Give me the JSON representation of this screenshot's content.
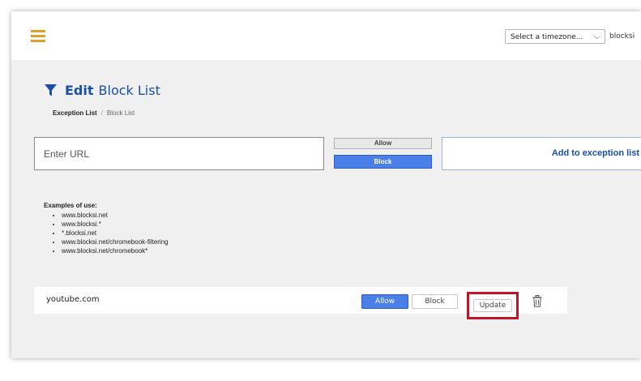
{
  "header": {
    "timezone_select": "Select a timezone...",
    "user_name": "blocksi"
  },
  "page": {
    "title_strong": "Edit",
    "title_rest": "Block List",
    "breadcrumb": [
      "Exception List",
      "Block List"
    ],
    "breadcrumb_separator": "/"
  },
  "form": {
    "url_placeholder": "Enter URL",
    "allow_label": "Allow",
    "block_label": "Block",
    "add_button": "Add to exception list"
  },
  "examples": {
    "title": "Examples of use:",
    "items": [
      "www.blocksi.net",
      "www.blocksi.*",
      "*.blocksi.net",
      "www.blocksi.net/chromebook-filtering",
      "www.blocksi.net/chromebook*"
    ]
  },
  "entries": [
    {
      "domain": "youtube.com",
      "allow_label": "Allow",
      "block_label": "Block",
      "update_label": "Update",
      "mode": "Allow"
    }
  ],
  "colors": {
    "accent": "#4a80e8",
    "title": "#1a4fa8",
    "hamburger": "#e0a030",
    "highlight": "#c0142a"
  },
  "icons": [
    "menu-icon",
    "filter-icon",
    "chevron-down-icon",
    "trash-icon"
  ]
}
